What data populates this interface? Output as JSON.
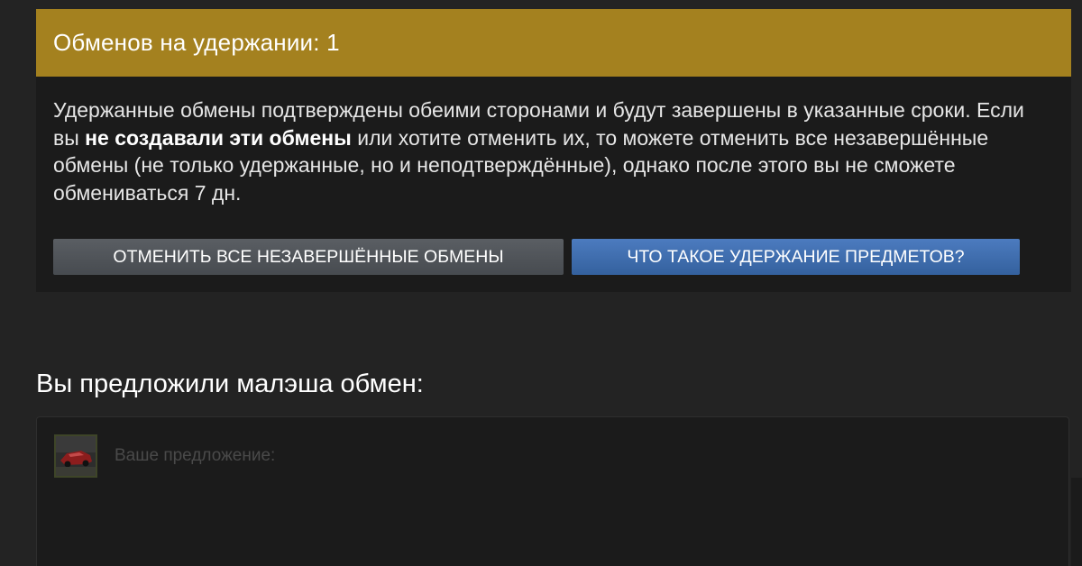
{
  "escrow": {
    "title": "Обменов на удержании: 1",
    "body_part1": "Удержанные обмены подтверждены обеими сторонами и будут завершены в указанные сроки. Если вы ",
    "body_bold": "не создавали эти обмены",
    "body_part2": " или хотите отменить их, то можете отменить все незавершённые обмены (не только удержанные, но и неподтверждённые), однако после этого вы не сможете обмениваться 7 дн.",
    "cancel_button": "ОТМЕНИТЬ ВСЕ НЕЗАВЕРШЁННЫЕ ОБМЕНЫ",
    "info_button": "ЧТО ТАКОЕ УДЕРЖАНИЕ ПРЕДМЕТОВ?"
  },
  "offer": {
    "heading": "Вы предложили малэша обмен:",
    "your_offer_label": "Ваше предложение:"
  },
  "colors": {
    "header_gold": "#a4811f",
    "panel_bg": "#1b1b1b",
    "page_bg": "#232323",
    "button_blue": "#3f6fb0",
    "button_gray": "#505459"
  }
}
